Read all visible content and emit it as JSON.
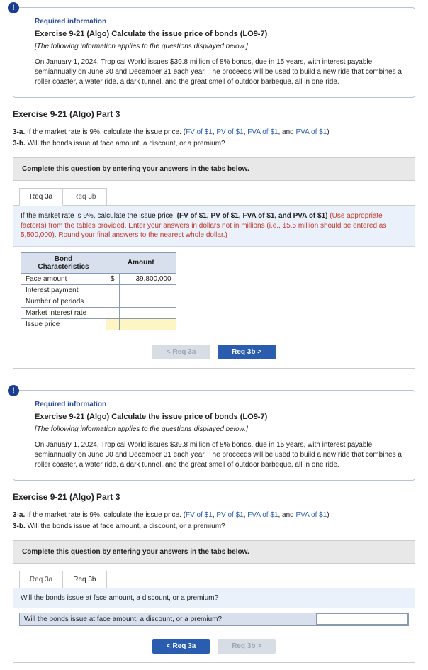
{
  "info": {
    "required": "Required information",
    "title": "Exercise 9-21 (Algo) Calculate the issue price of bonds (LO9-7)",
    "applies": "[The following information applies to the questions displayed below.]",
    "body": "On January 1, 2024, Tropical World issues $39.8 million of 8% bonds, due in 15 years, with interest payable semiannually on June 30 and December 31 each year. The proceeds will be used to build a new ride that combines a roller coaster, a water ride, a dark tunnel, and the great smell of outdoor barbeque, all in one ride."
  },
  "part": {
    "title": "Exercise 9-21 (Algo) Part 3",
    "q3a_prefix": "3-a.",
    "q3a_text": "If the market rate is 9%, calculate the issue price. (",
    "links": {
      "fv": "FV of $1",
      "pv": "PV of $1",
      "fva": "FVA of $1",
      "pva": "PVA of $1"
    },
    "and": ", and ",
    "close": ")",
    "q3b_prefix": "3-b.",
    "q3b_text": "Will the bonds issue at face amount, a discount, or a premium?"
  },
  "answer": {
    "head": "Complete this question by entering your answers in the tabs below.",
    "tab3a": "Req 3a",
    "tab3b": "Req 3b",
    "instr_lead": "If the market rate is 9%, calculate the issue price.",
    "instr_bold": "(FV of $1, PV of $1, FVA of $1, and PVA of $1)",
    "instr_red": " (Use appropriate factor(s) from the tables provided. Enter your answers in dollars not in millions (i.e., $5.5 million should be entered as 5,500,000). Round your final answers to the nearest whole dollar.)",
    "table": {
      "h1": "Bond Characteristics",
      "h2": "Amount",
      "rows": {
        "r1": "Face amount",
        "r2": "Interest payment",
        "r3": "Number of periods",
        "r4": "Market interest rate",
        "r5": "Issue price"
      },
      "dollar": "$",
      "face_val": "39,800,000"
    },
    "btn_prev": "<  Req 3a",
    "btn_next": "Req 3b  >",
    "q3b_question": "Will the bonds issue at face amount, a discount, or a premium?",
    "q3b_row_label": "Will the bonds issue at face amount, a discount, or a premium?",
    "btn_prev2": "<  Req 3a",
    "btn_next2": "Req 3b  >"
  }
}
